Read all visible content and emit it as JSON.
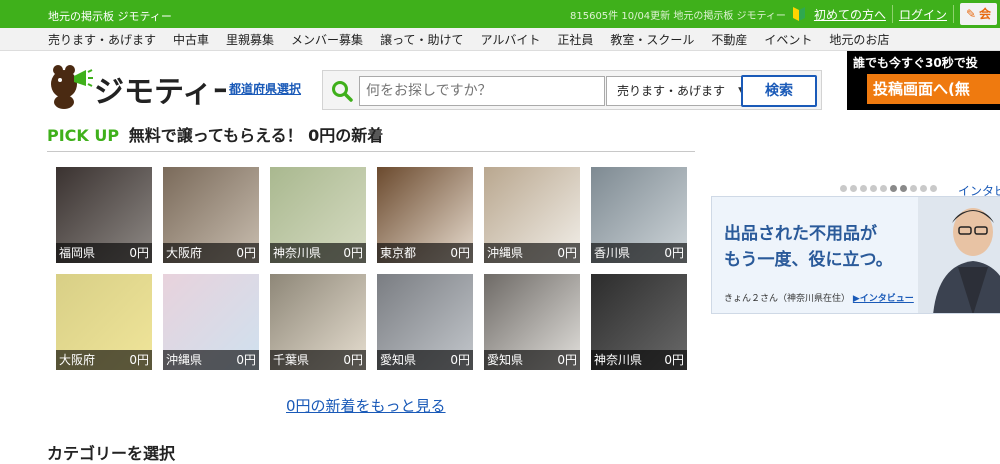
{
  "topbar": {
    "tagline": "地元の掲示板 ジモティー",
    "stats": "815605件 10/04更新 地元の掲示板 ジモティー",
    "first_time": "初めての方へ",
    "login": "ログイン",
    "post_button": "会"
  },
  "nav": {
    "items": [
      "売ります・あげます",
      "中古車",
      "里親募集",
      "メンバー募集",
      "譲って・助けて",
      "アルバイト",
      "正社員",
      "教室・スクール",
      "不動産",
      "イベント",
      "地元のお店"
    ]
  },
  "header": {
    "logo_text": "ジモティー",
    "pref_link": "都道府県選択",
    "search_placeholder": "何をお探しですか？",
    "select_value": "売ります・あげます",
    "search_button": "検索"
  },
  "promo": {
    "line1": "誰でも今すぐ30秒で投",
    "line2": "投稿画面へ(無"
  },
  "pickup": {
    "label_green": "PICK UP",
    "label": "無料で譲ってもらえる！ 0円の新着"
  },
  "items": [
    {
      "pref": "福岡県",
      "price": "0円",
      "colors": [
        "#3a3230",
        "#8f8a86"
      ]
    },
    {
      "pref": "大阪府",
      "price": "0円",
      "colors": [
        "#7a6a5a",
        "#c9beb0"
      ]
    },
    {
      "pref": "神奈川県",
      "price": "0円",
      "colors": [
        "#a9b88f",
        "#d7dcc3"
      ]
    },
    {
      "pref": "東京都",
      "price": "0円",
      "colors": [
        "#6b4a2e",
        "#e8ddd0"
      ]
    },
    {
      "pref": "沖縄県",
      "price": "0円",
      "colors": [
        "#b9a78f",
        "#f2efe9"
      ]
    },
    {
      "pref": "香川県",
      "price": "0円",
      "colors": [
        "#7e8a92",
        "#cfd6da"
      ]
    },
    {
      "pref": "大阪府",
      "price": "0円",
      "colors": [
        "#d8cf86",
        "#f0e59a"
      ]
    },
    {
      "pref": "沖縄県",
      "price": "0円",
      "colors": [
        "#e8d2dc",
        "#cfe1ef"
      ]
    },
    {
      "pref": "千葉県",
      "price": "0円",
      "colors": [
        "#8e8778",
        "#e6ded0"
      ]
    },
    {
      "pref": "愛知県",
      "price": "0円",
      "colors": [
        "#7a7d82",
        "#c3c7cc"
      ]
    },
    {
      "pref": "愛知県",
      "price": "0円",
      "colors": [
        "#6e6a66",
        "#e2e0dc"
      ]
    },
    {
      "pref": "神奈川県",
      "price": "0円",
      "colors": [
        "#2c2c2c",
        "#6a6a6a"
      ]
    }
  ],
  "more_link": "0円の新着をもっと見る",
  "category_heading": "カテゴリーを選択",
  "ad": {
    "interview_link": "インタビ",
    "headline_1": "出品された不用品が",
    "headline_2": "もう一度、役に立つ。",
    "credit": "きょん２さん（神奈川県在住）",
    "credit_link": "▶インタビュー",
    "dot_count": 10,
    "active_dots": [
      5,
      6
    ]
  },
  "colors": {
    "brand_green": "#3fb01b",
    "link_blue": "#1a5ab8",
    "post_orange": "#ef7a0f"
  }
}
